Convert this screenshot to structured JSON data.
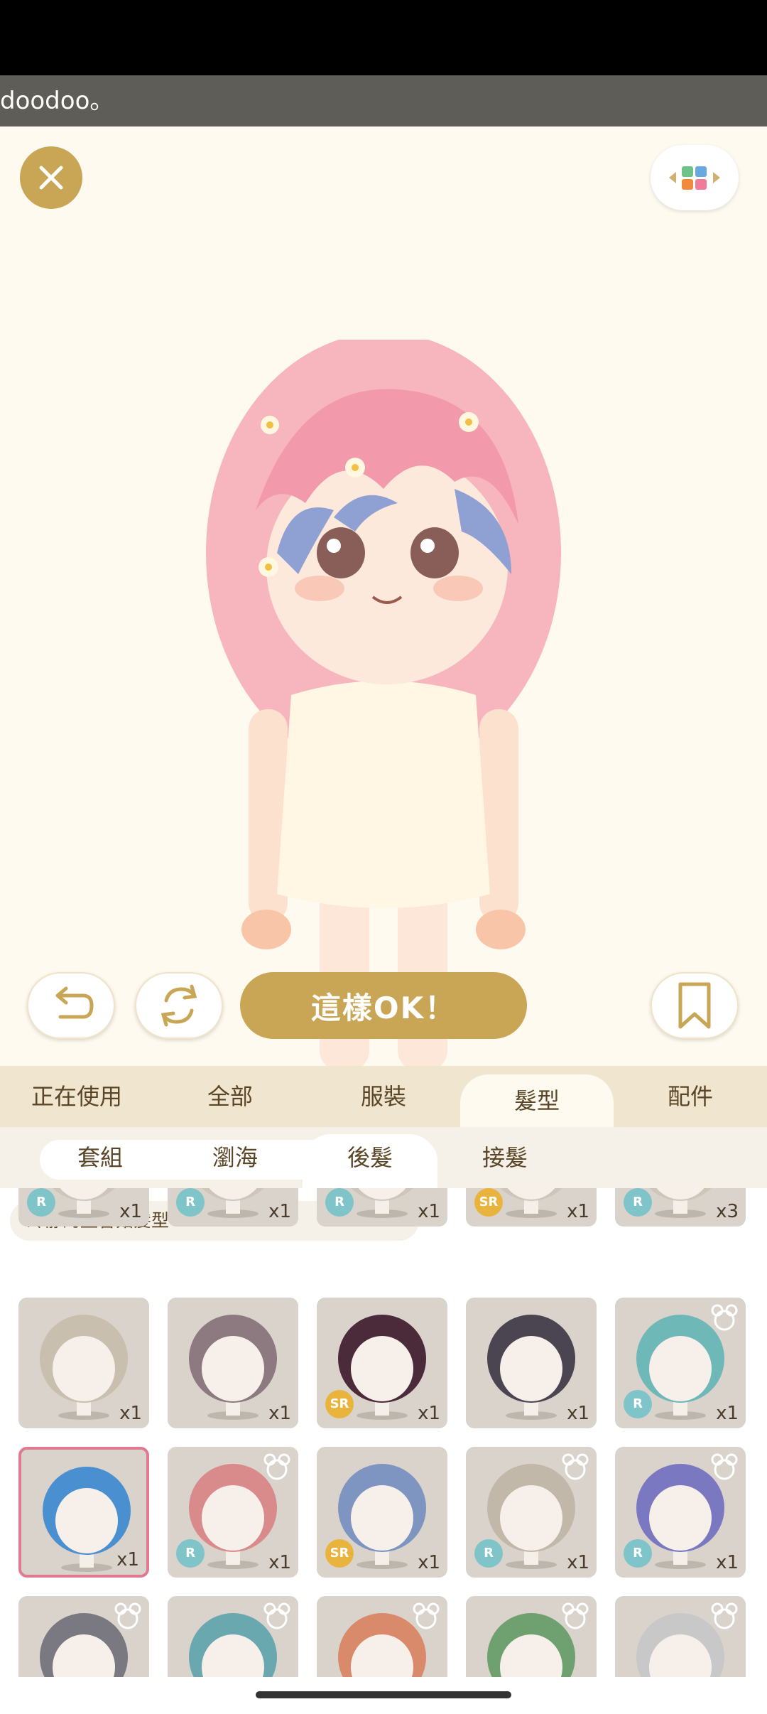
{
  "toast": {
    "text": "doodoo。"
  },
  "actions": {
    "ok_label": "這樣OK！"
  },
  "category_tabs": [
    {
      "label": "正在使用",
      "active": false
    },
    {
      "label": "全部",
      "active": false
    },
    {
      "label": "服裝",
      "active": false
    },
    {
      "label": "髮型",
      "active": true
    },
    {
      "label": "配件",
      "active": false
    }
  ],
  "sub_tabs": [
    {
      "label": "套組",
      "active": false
    },
    {
      "label": "瀏海",
      "active": false
    },
    {
      "label": "後髮",
      "active": true
    },
    {
      "label": "接髮",
      "active": false
    }
  ],
  "selected_item_name": "冷靜的藍香菇髮型",
  "partial_row": [
    {
      "rarity": "R",
      "count": "x1"
    },
    {
      "rarity": "R",
      "count": "x1"
    },
    {
      "rarity": "R",
      "count": "x1"
    },
    {
      "rarity": "SR",
      "count": "x1"
    },
    {
      "rarity": "R",
      "count": "x3"
    }
  ],
  "row1": [
    {
      "rarity": "",
      "count": "x1",
      "hair": "#c9bfae",
      "bear": false
    },
    {
      "rarity": "",
      "count": "x1",
      "hair": "#8d7a80",
      "bear": false
    },
    {
      "rarity": "SR",
      "count": "x1",
      "hair": "#4b2a3a",
      "bear": false
    },
    {
      "rarity": "",
      "count": "x1",
      "hair": "#4a4550",
      "bear": false
    },
    {
      "rarity": "R",
      "count": "x1",
      "hair": "#6fb8b8",
      "bear": true
    }
  ],
  "row2": [
    {
      "rarity": "",
      "count": "x1",
      "hair": "#4a8fd0",
      "bear": false,
      "selected": true
    },
    {
      "rarity": "R",
      "count": "x1",
      "hair": "#d98a8a",
      "bear": true
    },
    {
      "rarity": "SR",
      "count": "x1",
      "hair": "#7d95c0",
      "bear": false
    },
    {
      "rarity": "R",
      "count": "x1",
      "hair": "#c2b8aa",
      "bear": true
    },
    {
      "rarity": "R",
      "count": "x1",
      "hair": "#7a78c0",
      "bear": true
    }
  ],
  "row3": [
    {
      "hair": "#7a7880",
      "bear": true
    },
    {
      "hair": "#6aa8b0",
      "bear": true
    },
    {
      "hair": "#d98a6a",
      "bear": true
    },
    {
      "hair": "#6fa070",
      "bear": true
    },
    {
      "hair": "#c8c8c8",
      "bear": true
    }
  ],
  "colors": {
    "accent": "#c9a655",
    "selected_border": "#e07a90"
  }
}
